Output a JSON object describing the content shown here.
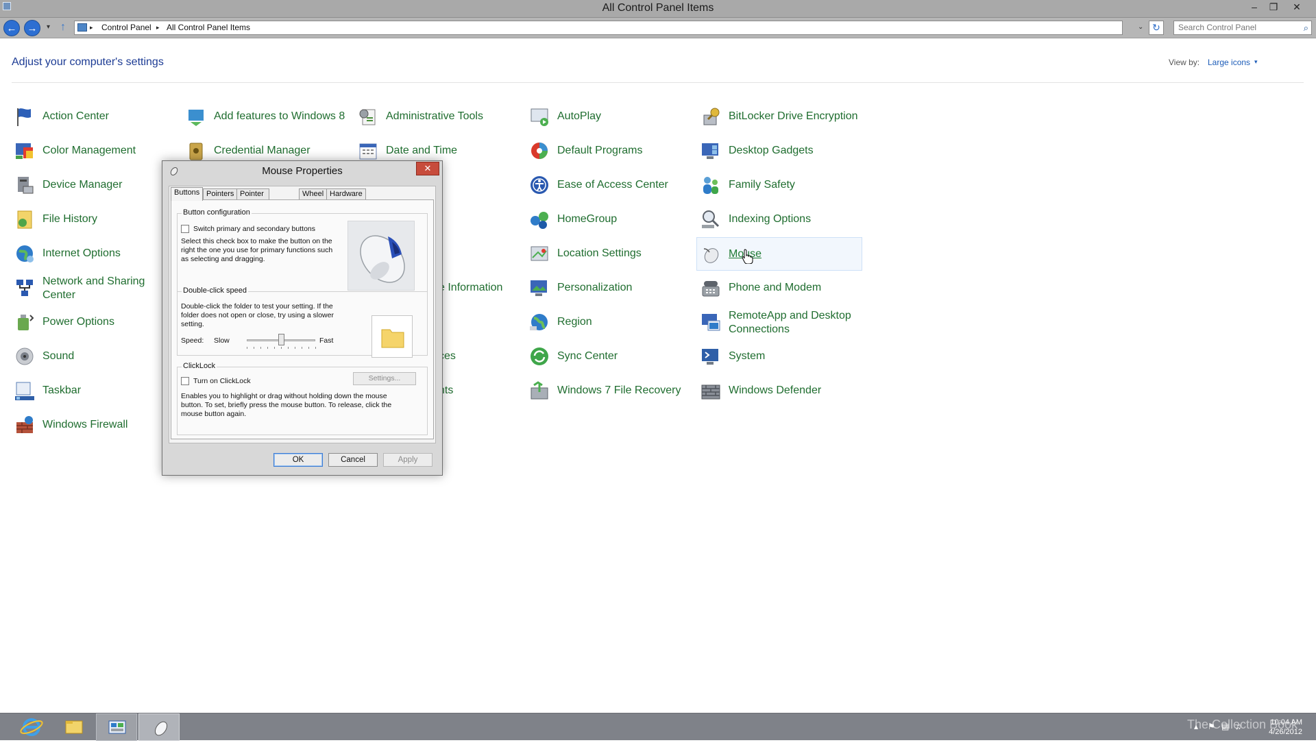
{
  "window": {
    "title": "All Control Panel Items",
    "minimize": "–",
    "restore": "❐",
    "close": "✕"
  },
  "address": {
    "back": "←",
    "forward": "→",
    "recent": "▾",
    "up": "↑",
    "crumbs": [
      "Control Panel",
      "All Control Panel Items"
    ],
    "sep": "▸",
    "dropdown": "⌄",
    "refresh": "↻",
    "search_placeholder": "Search Control Panel",
    "search_icon": "⌕"
  },
  "content": {
    "heading": "Adjust your computer's settings",
    "view_by_label": "View by:",
    "view_by_value": "Large icons",
    "view_by_caret": "▾"
  },
  "items": {
    "c1": [
      "Action Center",
      "Color Management",
      "Device Manager",
      "File History",
      "Internet Options",
      "Network and Sharing Center",
      "Power Options",
      "Sound",
      "Taskbar",
      "Windows Firewall"
    ],
    "c2": [
      "Add features to Windows 8",
      "Credential Manager"
    ],
    "c2_partial": [
      "e Information",
      "ces",
      "nts"
    ],
    "c3": [
      "Administrative Tools",
      "Date and Time"
    ],
    "c4": [
      "AutoPlay",
      "Default Programs",
      "Ease of Access Center",
      "HomeGroup",
      "Location Settings",
      "Personalization",
      "Region",
      "Sync Center",
      "Windows 7 File Recovery"
    ],
    "c5": [
      "BitLocker Drive Encryption",
      "Desktop Gadgets",
      "Family Safety",
      "Indexing Options",
      "Mouse",
      "Phone and Modem",
      "RemoteApp and Desktop Connections",
      "System",
      "Windows Defender"
    ]
  },
  "dialog": {
    "title": "Mouse Properties",
    "close": "✕",
    "tabs": [
      "Buttons",
      "Pointers",
      "Pointer Options",
      "Wheel",
      "Hardware"
    ],
    "button_config": {
      "label": "Button configuration",
      "checkbox": "Switch primary and secondary buttons",
      "desc1": "Select this check box to make the button on the",
      "desc2": "right the one you use for primary functions such",
      "desc3": "as selecting and dragging."
    },
    "double_click": {
      "label": "Double-click speed",
      "desc1": "Double-click the folder to test your setting. If the",
      "desc2": "folder does not open or close, try using a slower",
      "desc3": "setting.",
      "speed": "Speed:",
      "slow": "Slow",
      "fast": "Fast",
      "speed_level": 0.5
    },
    "clicklock": {
      "label": "ClickLock",
      "checkbox": "Turn on ClickLock",
      "settings": "Settings...",
      "desc1": "Enables you to highlight or drag without holding down the mouse",
      "desc2": "button. To set, briefly press the mouse button. To release, click the",
      "desc3": "mouse button again."
    },
    "ok": "OK",
    "cancel": "Cancel",
    "apply": "Apply"
  },
  "taskbar": {
    "clock_time": "10:04 AM",
    "clock_date": "4/26/2012",
    "watermark": "The Collection Book",
    "tray_icons": [
      "▴",
      "⚑",
      "▤",
      "♫"
    ]
  },
  "colors": {
    "link_green": "#1f6d2f",
    "heading_blue": "#1c3b94",
    "taskbar": "#7f8289"
  }
}
